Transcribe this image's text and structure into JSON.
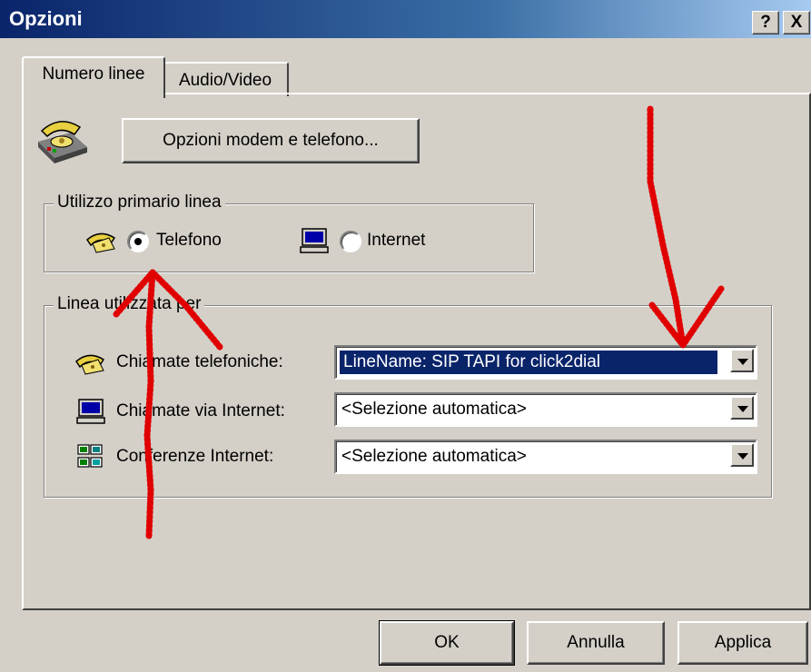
{
  "window": {
    "title": "Opzioni",
    "help_label": "?",
    "close_label": "X"
  },
  "tabs": [
    {
      "label": "Numero linee"
    },
    {
      "label": "Audio/Video"
    }
  ],
  "modem_button": {
    "label": "Opzioni modem e telefono..."
  },
  "primary_usage": {
    "legend": "Utilizzo primario linea",
    "options": [
      {
        "label": "Telefono",
        "selected": true,
        "icon": "telephone-icon"
      },
      {
        "label": "Internet",
        "selected": false,
        "icon": "computer-icon"
      }
    ]
  },
  "line_usage": {
    "legend": "Linea utilizzata per",
    "rows": [
      {
        "label": "Chiamate telefoniche:",
        "value": "LineName: SIP TAPI for click2dial",
        "icon": "telephone-icon"
      },
      {
        "label": "Chiamate via Internet:",
        "value": "<Selezione automatica>",
        "icon": "computer-icon"
      },
      {
        "label": "Conferenze Internet:",
        "value": "<Selezione automatica>",
        "icon": "conference-icon"
      }
    ]
  },
  "footer": {
    "ok": "OK",
    "cancel": "Annulla",
    "apply": "Applica"
  },
  "colors": {
    "title_bar": "#0a246a",
    "face": "#d4d0c8",
    "selection": "#0a246a",
    "annotation": "#e00000"
  }
}
